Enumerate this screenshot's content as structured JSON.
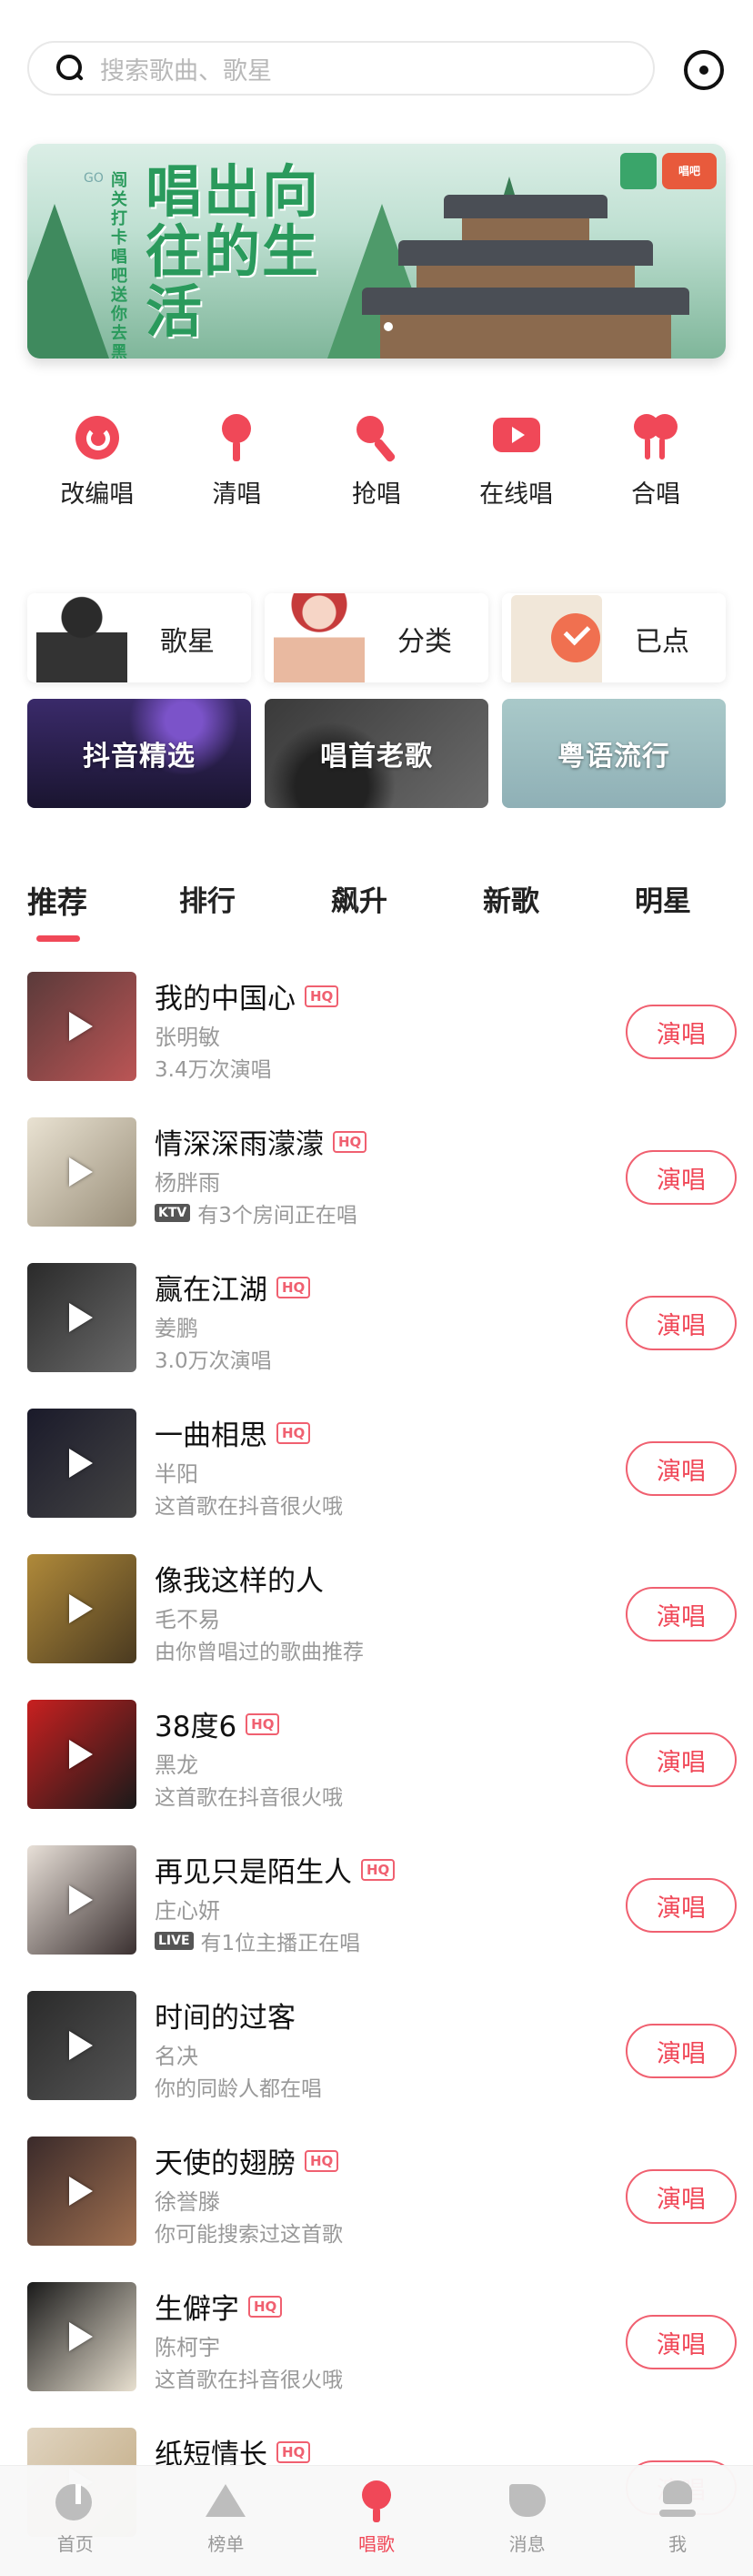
{
  "search": {
    "placeholder": "搜索歌曲、歌星"
  },
  "banner": {
    "title": "唱出向往的生活",
    "side_text": "闯关打卡 唱吧送你去黑西",
    "side_small": "GO",
    "logo_text": "唱吧"
  },
  "actions": [
    {
      "label": "改编唱",
      "icon": "rework-icon"
    },
    {
      "label": "清唱",
      "icon": "mic-icon"
    },
    {
      "label": "抢唱",
      "icon": "grab-mic-icon"
    },
    {
      "label": "在线唱",
      "icon": "live-tv-icon"
    },
    {
      "label": "合唱",
      "icon": "duet-icon"
    }
  ],
  "categories": [
    {
      "label": "歌星"
    },
    {
      "label": "分类"
    },
    {
      "label": "已点"
    }
  ],
  "tiles": [
    {
      "label": "抖音精选"
    },
    {
      "label": "唱首老歌"
    },
    {
      "label": "粤语流行"
    }
  ],
  "tabs": [
    "推荐",
    "排行",
    "飙升",
    "新歌",
    "明星"
  ],
  "sing_label": "演唱",
  "hq_label": "HQ",
  "songs": [
    {
      "title": "我的中国心",
      "hq": true,
      "artist": "张明敏",
      "badge": "",
      "desc": "3.4万次演唱",
      "cover": [
        "#5a3a3a",
        "#b55"
      ]
    },
    {
      "title": "情深深雨濛濛",
      "hq": true,
      "artist": "杨胖雨",
      "badge": "KTV",
      "desc": "有3个房间正在唱",
      "cover": [
        "#e9e2d2",
        "#9a8f7a"
      ]
    },
    {
      "title": "赢在江湖",
      "hq": true,
      "artist": "姜鹏",
      "badge": "",
      "desc": "3.0万次演唱",
      "cover": [
        "#2a2a2a",
        "#6a6a6a"
      ]
    },
    {
      "title": "一曲相思",
      "hq": true,
      "artist": "半阳",
      "badge": "",
      "desc": "这首歌在抖音很火哦",
      "cover": [
        "#1a1a2a",
        "#444"
      ]
    },
    {
      "title": "像我这样的人",
      "hq": false,
      "artist": "毛不易",
      "badge": "",
      "desc": "由你曾唱过的歌曲推荐",
      "cover": [
        "#b08a3a",
        "#4a3a20"
      ]
    },
    {
      "title": "38度6",
      "hq": true,
      "artist": "黑龙",
      "badge": "",
      "desc": "这首歌在抖音很火哦",
      "cover": [
        "#c82020",
        "#1a1a1a"
      ]
    },
    {
      "title": "再见只是陌生人",
      "hq": true,
      "artist": "庄心妍",
      "badge": "LIVE",
      "desc": "有1位主播正在唱",
      "cover": [
        "#e8e0d8",
        "#3a3030"
      ]
    },
    {
      "title": "时间的过客",
      "hq": false,
      "artist": "名决",
      "badge": "",
      "desc": "你的同龄人都在唱",
      "cover": [
        "#2a2a2a",
        "#555"
      ]
    },
    {
      "title": "天使的翅膀",
      "hq": true,
      "artist": "徐誉滕",
      "badge": "",
      "desc": "你可能搜索过这首歌",
      "cover": [
        "#3a2a2a",
        "#a07050"
      ]
    },
    {
      "title": "生僻字",
      "hq": true,
      "artist": "陈柯宇",
      "badge": "",
      "desc": "这首歌在抖音很火哦",
      "cover": [
        "#1a1a1a",
        "#e8e0d0"
      ]
    },
    {
      "title": "纸短情长",
      "hq": true,
      "artist": "",
      "badge": "",
      "desc": "",
      "cover": [
        "#e0d4c0",
        "#c0a880"
      ]
    }
  ],
  "nav": [
    {
      "label": "首页",
      "icon": "home-icon",
      "active": false
    },
    {
      "label": "榜单",
      "icon": "chart-icon",
      "active": false
    },
    {
      "label": "唱歌",
      "icon": "sing-mic-icon",
      "active": true
    },
    {
      "label": "消息",
      "icon": "message-icon",
      "active": false
    },
    {
      "label": "我",
      "icon": "profile-icon",
      "active": false
    }
  ],
  "colors": {
    "accent": "#f04858",
    "muted": "#999999"
  }
}
